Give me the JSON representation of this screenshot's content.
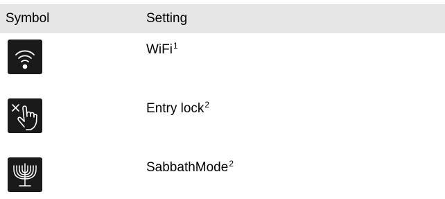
{
  "header": {
    "symbol_label": "Symbol",
    "setting_label": "Setting"
  },
  "rows": [
    {
      "icon": "wifi-icon",
      "setting": "WiFi",
      "footnote": "1"
    },
    {
      "icon": "touch-lock-icon",
      "setting": "Entry lock",
      "footnote": "2"
    },
    {
      "icon": "menorah-icon",
      "setting": "SabbathMode",
      "footnote": "2"
    }
  ],
  "colors": {
    "header_bg": "#e6e6e6",
    "icon_bg": "#1a1a1a",
    "icon_fg": "#ffffff"
  }
}
